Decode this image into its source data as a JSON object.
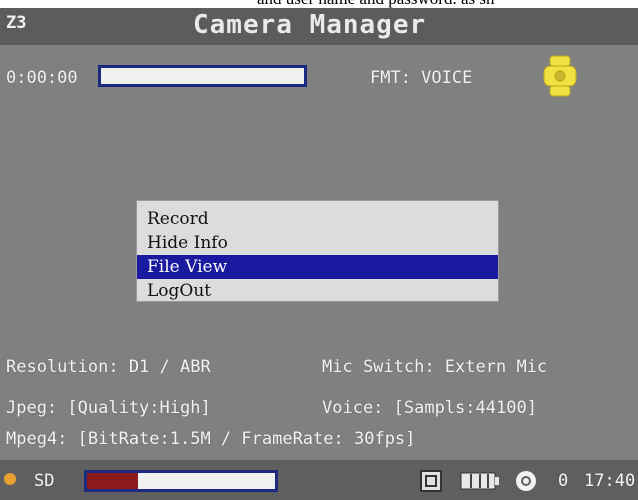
{
  "caption": {
    "text": "and user name and password. as sh"
  },
  "title_bar": {
    "channel": "Z3",
    "title": "Camera Manager"
  },
  "status": {
    "timer": "0:00:00",
    "format": "FMT: VOICE",
    "progress": 0
  },
  "menu": {
    "items": [
      {
        "label": "Record",
        "selected": false
      },
      {
        "label": "Hide Info",
        "selected": false
      },
      {
        "label": "File View",
        "selected": true
      },
      {
        "label": "LogOut",
        "selected": false
      }
    ]
  },
  "info": {
    "resolution": "Resolution: D1 / ABR",
    "mic_switch": "Mic Switch: Extern Mic",
    "jpeg": "Jpeg: [Quality:High]",
    "voice": "Voice: [Sampls:44100]",
    "mpeg4": "Mpeg4: [BitRate:1.5M / FrameRate: 30fps]"
  },
  "bottom_bar": {
    "storage": "SD",
    "storage_used": 0.27,
    "channel_marker": "0",
    "time": "17:40"
  },
  "colors": {
    "selection": "#1a1aa0",
    "bar_border": "#1c2a80",
    "bar_fill": "#8c1a1a",
    "icon_yellow": "#f0e040"
  },
  "icons": [
    "camera-status-icon",
    "sd-dot-icon",
    "sd-card-icon",
    "battery-icon",
    "record-ring-icon"
  ]
}
